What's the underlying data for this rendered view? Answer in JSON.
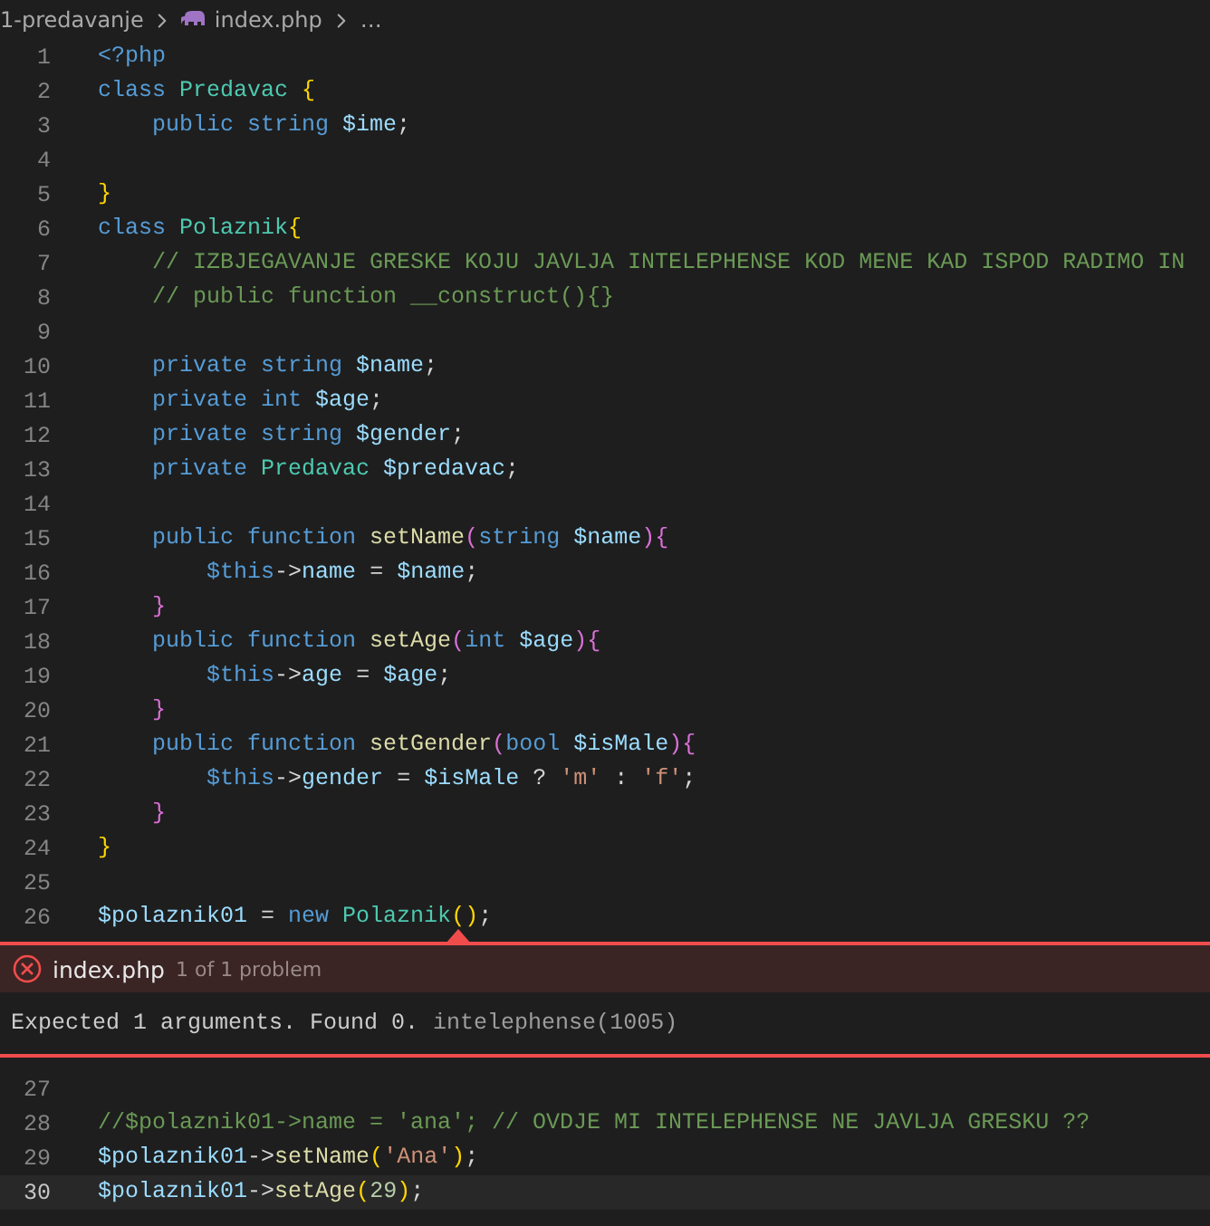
{
  "breadcrumb": {
    "folder": "1-predavanje",
    "file": "index.php",
    "more": "…"
  },
  "lines_before": [
    {
      "number": "1",
      "highlighted": false,
      "tokens": [
        {
          "kind": "tag",
          "text": "<?php"
        }
      ]
    },
    {
      "number": "2",
      "highlighted": false,
      "tokens": [
        {
          "kind": "keyword",
          "text": "class "
        },
        {
          "kind": "type",
          "text": "Predavac "
        },
        {
          "kind": "bracket",
          "text": "{"
        }
      ]
    },
    {
      "number": "3",
      "highlighted": false,
      "tokens": [
        {
          "kind": "keyword",
          "text": "    public string "
        },
        {
          "kind": "variable",
          "text": "$ime"
        },
        {
          "kind": "plain",
          "text": ";"
        }
      ]
    },
    {
      "number": "4",
      "highlighted": false
    },
    {
      "number": "5",
      "highlighted": false,
      "tokens": [
        {
          "kind": "bracket",
          "text": "}"
        }
      ]
    },
    {
      "number": "6",
      "highlighted": false,
      "tokens": [
        {
          "kind": "keyword",
          "text": "class "
        },
        {
          "kind": "type",
          "text": "Polaznik"
        },
        {
          "kind": "bracket",
          "text": "{"
        }
      ]
    },
    {
      "number": "7",
      "highlighted": false,
      "tokens": [
        {
          "kind": "comment",
          "text": "    // IZBJEGAVANJE GRESKE KOJU JAVLJA INTELEPHENSE KOD MENE KAD ISPOD RADIMO IN"
        }
      ]
    },
    {
      "number": "8",
      "highlighted": false,
      "tokens": [
        {
          "kind": "comment",
          "text": "    // public function __construct(){}"
        }
      ]
    },
    {
      "number": "9",
      "highlighted": false
    },
    {
      "number": "10",
      "highlighted": false,
      "tokens": [
        {
          "kind": "keyword",
          "text": "    private string "
        },
        {
          "kind": "variable",
          "text": "$name"
        },
        {
          "kind": "plain",
          "text": ";"
        }
      ]
    },
    {
      "number": "11",
      "highlighted": false,
      "tokens": [
        {
          "kind": "keyword",
          "text": "    private int "
        },
        {
          "kind": "variable",
          "text": "$age"
        },
        {
          "kind": "plain",
          "text": ";"
        }
      ]
    },
    {
      "number": "12",
      "highlighted": false,
      "tokens": [
        {
          "kind": "keyword",
          "text": "    private string "
        },
        {
          "kind": "variable",
          "text": "$gender"
        },
        {
          "kind": "plain",
          "text": ";"
        }
      ]
    },
    {
      "number": "13",
      "highlighted": false,
      "tokens": [
        {
          "kind": "keyword",
          "text": "    private "
        },
        {
          "kind": "type",
          "text": "Predavac "
        },
        {
          "kind": "variable",
          "text": "$predavac"
        },
        {
          "kind": "plain",
          "text": ";"
        }
      ]
    },
    {
      "number": "14",
      "highlighted": false
    },
    {
      "number": "15",
      "highlighted": false,
      "tokens": [
        {
          "kind": "keyword",
          "text": "    public function "
        },
        {
          "kind": "function",
          "text": "setName"
        },
        {
          "kind": "bracket2",
          "text": "("
        },
        {
          "kind": "keyword",
          "text": "string "
        },
        {
          "kind": "variable",
          "text": "$name"
        },
        {
          "kind": "bracket2",
          "text": "){"
        }
      ]
    },
    {
      "number": "16",
      "highlighted": false,
      "tokens": [
        {
          "kind": "keyword",
          "text": "        $this"
        },
        {
          "kind": "plain",
          "text": "->"
        },
        {
          "kind": "variable",
          "text": "name"
        },
        {
          "kind": "plain",
          "text": " = "
        },
        {
          "kind": "variable",
          "text": "$name"
        },
        {
          "kind": "plain",
          "text": ";"
        }
      ]
    },
    {
      "number": "17",
      "highlighted": false,
      "tokens": [
        {
          "kind": "bracket2",
          "text": "    }"
        }
      ]
    },
    {
      "number": "18",
      "highlighted": false,
      "tokens": [
        {
          "kind": "keyword",
          "text": "    public function "
        },
        {
          "kind": "function",
          "text": "setAge"
        },
        {
          "kind": "bracket2",
          "text": "("
        },
        {
          "kind": "keyword",
          "text": "int "
        },
        {
          "kind": "variable",
          "text": "$age"
        },
        {
          "kind": "bracket2",
          "text": "){"
        }
      ]
    },
    {
      "number": "19",
      "highlighted": false,
      "tokens": [
        {
          "kind": "keyword",
          "text": "        $this"
        },
        {
          "kind": "plain",
          "text": "->"
        },
        {
          "kind": "variable",
          "text": "age"
        },
        {
          "kind": "plain",
          "text": " = "
        },
        {
          "kind": "variable",
          "text": "$age"
        },
        {
          "kind": "plain",
          "text": ";"
        }
      ]
    },
    {
      "number": "20",
      "highlighted": false,
      "tokens": [
        {
          "kind": "bracket2",
          "text": "    }"
        }
      ]
    },
    {
      "number": "21",
      "highlighted": false,
      "tokens": [
        {
          "kind": "keyword",
          "text": "    public function "
        },
        {
          "kind": "function",
          "text": "setGender"
        },
        {
          "kind": "bracket2",
          "text": "("
        },
        {
          "kind": "keyword",
          "text": "bool "
        },
        {
          "kind": "variable",
          "text": "$isMale"
        },
        {
          "kind": "bracket2",
          "text": "){"
        }
      ]
    },
    {
      "number": "22",
      "highlighted": false,
      "tokens": [
        {
          "kind": "keyword",
          "text": "        $this"
        },
        {
          "kind": "plain",
          "text": "->"
        },
        {
          "kind": "variable",
          "text": "gender"
        },
        {
          "kind": "plain",
          "text": " = "
        },
        {
          "kind": "variable",
          "text": "$isMale"
        },
        {
          "kind": "plain",
          "text": " ? "
        },
        {
          "kind": "string",
          "text": "'m'"
        },
        {
          "kind": "plain",
          "text": " : "
        },
        {
          "kind": "string",
          "text": "'f'"
        },
        {
          "kind": "plain",
          "text": ";"
        }
      ]
    },
    {
      "number": "23",
      "highlighted": false,
      "tokens": [
        {
          "kind": "bracket2",
          "text": "    }"
        }
      ]
    },
    {
      "number": "24",
      "highlighted": false,
      "tokens": [
        {
          "kind": "bracket",
          "text": "}"
        }
      ]
    },
    {
      "number": "25",
      "highlighted": false
    },
    {
      "number": "26",
      "highlighted": false,
      "tokens": [
        {
          "kind": "variable",
          "text": "$polaznik01"
        },
        {
          "kind": "plain",
          "text": " = "
        },
        {
          "kind": "keyword",
          "text": "new "
        },
        {
          "kind": "type",
          "text": "Polaznik"
        },
        {
          "kind": "bracket",
          "text": "()"
        },
        {
          "kind": "plain",
          "text": ";"
        }
      ]
    }
  ],
  "problem": {
    "file": "index.php",
    "count": "1 of 1 problem",
    "message": "Expected 1 arguments. Found 0.",
    "source": "intelephense(1005)"
  },
  "lines_after": [
    {
      "number": "27",
      "highlighted": false
    },
    {
      "number": "28",
      "highlighted": false,
      "tokens": [
        {
          "kind": "comment",
          "text": "//$polaznik01->name = 'ana'; // OVDJE MI INTELEPHENSE NE JAVLJA GRESKU ??"
        }
      ]
    },
    {
      "number": "29",
      "highlighted": false,
      "tokens": [
        {
          "kind": "variable",
          "text": "$polaznik01"
        },
        {
          "kind": "plain",
          "text": "->"
        },
        {
          "kind": "function",
          "text": "setName"
        },
        {
          "kind": "bracket",
          "text": "("
        },
        {
          "kind": "string",
          "text": "'Ana'"
        },
        {
          "kind": "bracket",
          "text": ")"
        },
        {
          "kind": "plain",
          "text": ";"
        }
      ]
    },
    {
      "number": "30",
      "highlighted": true,
      "tokens": [
        {
          "kind": "variable",
          "text": "$polaznik01"
        },
        {
          "kind": "plain",
          "text": "->"
        },
        {
          "kind": "function",
          "text": "setAge"
        },
        {
          "kind": "bracket",
          "text": "("
        },
        {
          "kind": "number",
          "text": "29"
        },
        {
          "kind": "bracket",
          "text": ")"
        },
        {
          "kind": "plain",
          "text": ";"
        }
      ]
    }
  ]
}
